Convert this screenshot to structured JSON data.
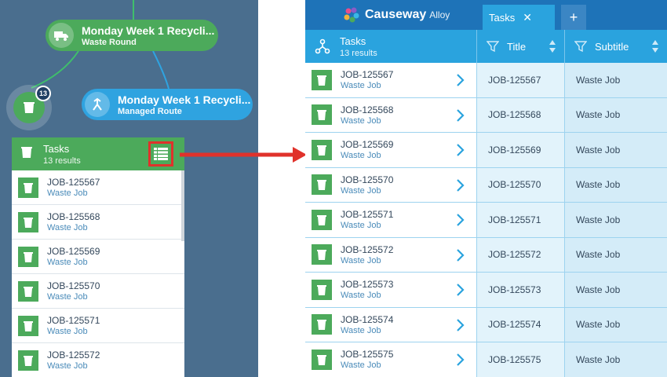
{
  "map": {
    "round_node": {
      "title": "Monday Week 1 Recycli...",
      "subtitle": "Waste Round"
    },
    "route_node": {
      "title": "Monday Week 1 Recycli...",
      "subtitle": "Managed Route"
    },
    "cluster_count": "13"
  },
  "left_panel": {
    "title": "Tasks",
    "subtitle": "13 results",
    "rows": [
      {
        "title": "JOB-125567",
        "subtitle": "Waste Job"
      },
      {
        "title": "JOB-125568",
        "subtitle": "Waste Job"
      },
      {
        "title": "JOB-125569",
        "subtitle": "Waste Job"
      },
      {
        "title": "JOB-125570",
        "subtitle": "Waste Job"
      },
      {
        "title": "JOB-125571",
        "subtitle": "Waste Job"
      },
      {
        "title": "JOB-125572",
        "subtitle": "Waste Job"
      }
    ]
  },
  "right_panel": {
    "brand": {
      "name": "Causeway",
      "product": "Alloy"
    },
    "tab_label": "Tasks",
    "tab_close": "✕",
    "tab_add": "+",
    "header": {
      "title": "Tasks",
      "subtitle": "13 results",
      "col_title": "Title",
      "col_subtitle": "Subtitle"
    },
    "rows": [
      {
        "title": "JOB-125567",
        "subtitle": "Waste Job",
        "col_title": "JOB-125567",
        "col_subtitle": "Waste Job"
      },
      {
        "title": "JOB-125568",
        "subtitle": "Waste Job",
        "col_title": "JOB-125568",
        "col_subtitle": "Waste Job"
      },
      {
        "title": "JOB-125569",
        "subtitle": "Waste Job",
        "col_title": "JOB-125569",
        "col_subtitle": "Waste Job"
      },
      {
        "title": "JOB-125570",
        "subtitle": "Waste Job",
        "col_title": "JOB-125570",
        "col_subtitle": "Waste Job"
      },
      {
        "title": "JOB-125571",
        "subtitle": "Waste Job",
        "col_title": "JOB-125571",
        "col_subtitle": "Waste Job"
      },
      {
        "title": "JOB-125572",
        "subtitle": "Waste Job",
        "col_title": "JOB-125572",
        "col_subtitle": "Waste Job"
      },
      {
        "title": "JOB-125573",
        "subtitle": "Waste Job",
        "col_title": "JOB-125573",
        "col_subtitle": "Waste Job"
      },
      {
        "title": "JOB-125574",
        "subtitle": "Waste Job",
        "col_title": "JOB-125574",
        "col_subtitle": "Waste Job"
      },
      {
        "title": "JOB-125575",
        "subtitle": "Waste Job",
        "col_title": "JOB-125575",
        "col_subtitle": "Waste Job"
      }
    ]
  },
  "colors": {
    "green": "#4caa5b",
    "blue": "#2aa3de",
    "dark_blue": "#1e73b8",
    "map_bg": "#4a6e8e",
    "highlight": "#e0322b"
  },
  "icons": [
    "truck-icon",
    "route-icon",
    "bin-icon",
    "table-view-icon",
    "arrow-icon",
    "filter-icon",
    "sort-icon",
    "chevron-right-icon",
    "causeway-logo-icon"
  ]
}
